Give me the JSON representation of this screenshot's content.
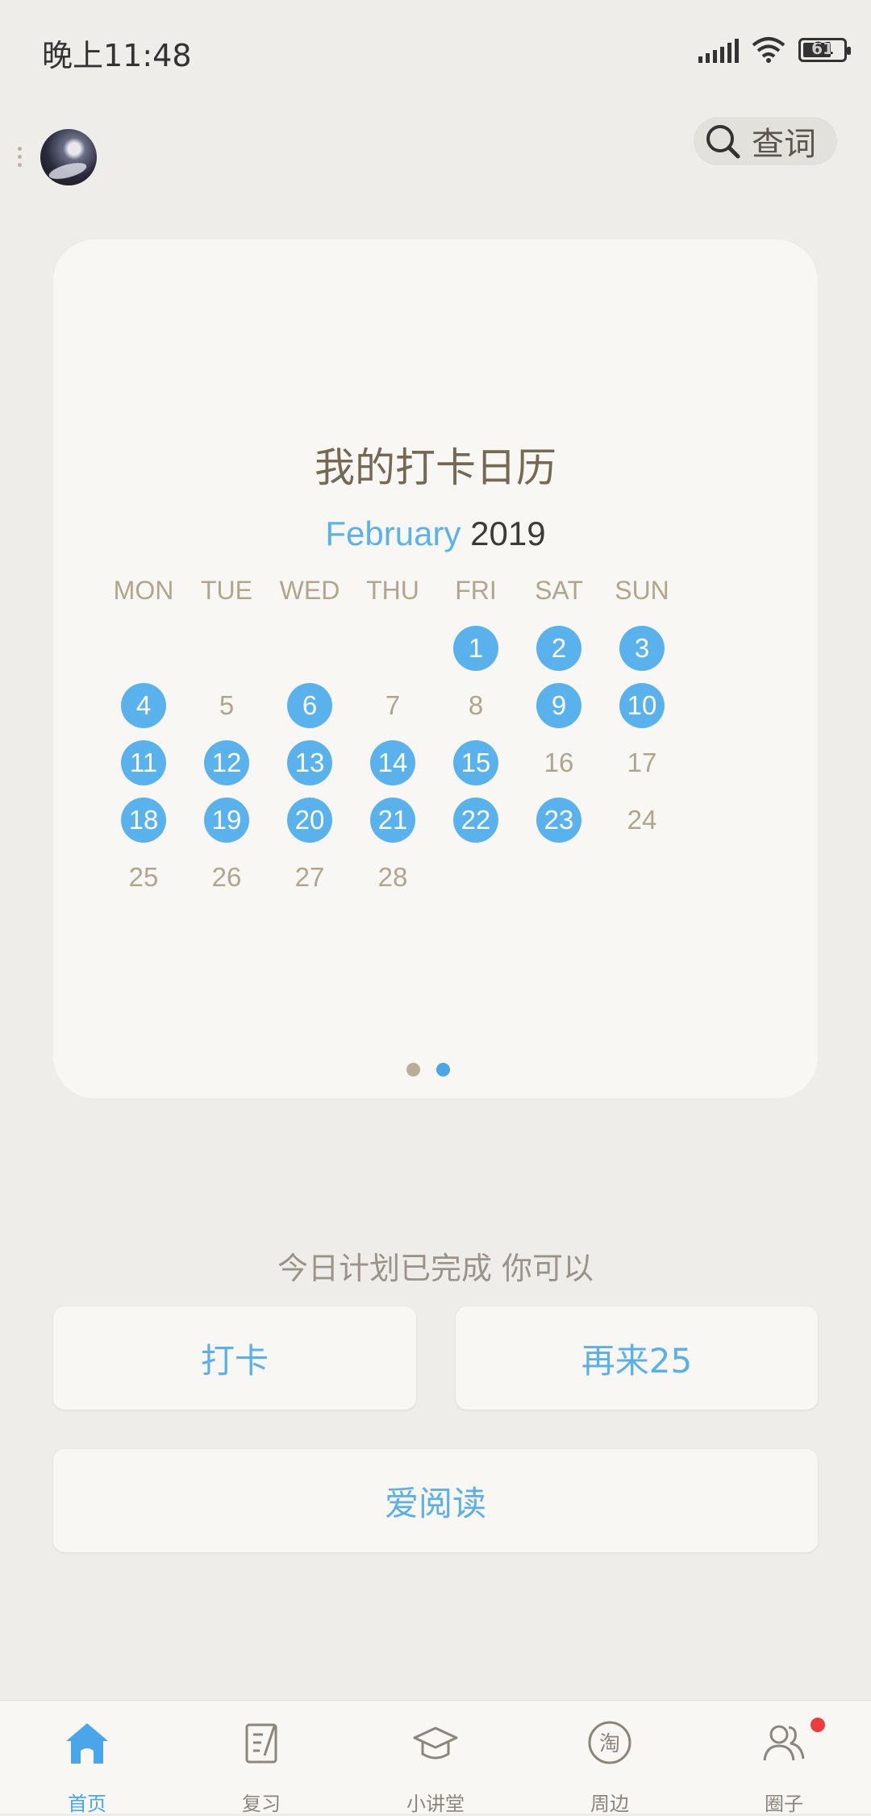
{
  "status_bar": {
    "time": "晚上11:48",
    "battery": "61"
  },
  "header": {
    "search_label": "查词"
  },
  "calendar": {
    "title": "我的打卡日历",
    "month": "February",
    "year": "2019",
    "weekdays": [
      "MON",
      "TUE",
      "WED",
      "THU",
      "FRI",
      "SAT",
      "SUN"
    ],
    "days": [
      {
        "n": "1",
        "checked": true
      },
      {
        "n": "2",
        "checked": true
      },
      {
        "n": "3",
        "checked": true
      },
      {
        "n": "4",
        "checked": true
      },
      {
        "n": "5",
        "checked": false
      },
      {
        "n": "6",
        "checked": true
      },
      {
        "n": "7",
        "checked": false
      },
      {
        "n": "8",
        "checked": false
      },
      {
        "n": "9",
        "checked": true
      },
      {
        "n": "10",
        "checked": true
      },
      {
        "n": "11",
        "checked": true
      },
      {
        "n": "12",
        "checked": true
      },
      {
        "n": "13",
        "checked": true
      },
      {
        "n": "14",
        "checked": true
      },
      {
        "n": "15",
        "checked": true
      },
      {
        "n": "16",
        "checked": false
      },
      {
        "n": "17",
        "checked": false
      },
      {
        "n": "18",
        "checked": true
      },
      {
        "n": "19",
        "checked": true
      },
      {
        "n": "20",
        "checked": true
      },
      {
        "n": "21",
        "checked": true
      },
      {
        "n": "22",
        "checked": true
      },
      {
        "n": "23",
        "checked": true
      },
      {
        "n": "24",
        "checked": false
      },
      {
        "n": "25",
        "checked": false
      },
      {
        "n": "26",
        "checked": false
      },
      {
        "n": "27",
        "checked": false
      },
      {
        "n": "28",
        "checked": false
      }
    ],
    "page_index": 2,
    "page_count": 2
  },
  "plan": {
    "status_text": "今日计划已完成 你可以",
    "checkin_label": "打卡",
    "more_label": "再来25",
    "read_label": "爱阅读"
  },
  "tabs": [
    {
      "label": "首页",
      "icon": "home-icon",
      "active": true
    },
    {
      "label": "复习",
      "icon": "review-icon",
      "active": false
    },
    {
      "label": "小讲堂",
      "icon": "graduation-cap-icon",
      "active": false
    },
    {
      "label": "周边",
      "icon": "taobao-icon",
      "active": false
    },
    {
      "label": "圈子",
      "icon": "group-icon",
      "active": false,
      "badge": true
    }
  ],
  "colors": {
    "accent": "#5AB2EC",
    "checked_day": "#5AB2EC",
    "muted_text": "#B0A58E",
    "badge": "#EE3B3B"
  }
}
